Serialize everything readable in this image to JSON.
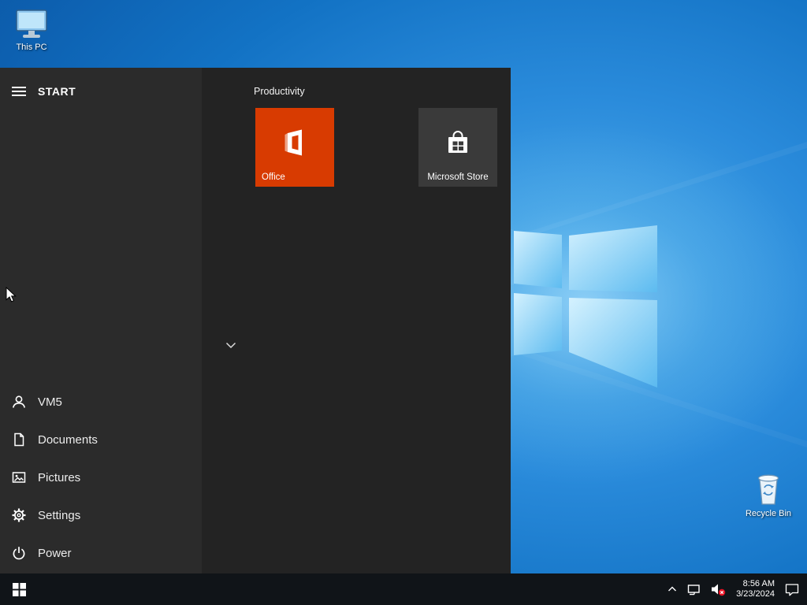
{
  "colors": {
    "taskbar_bg": "#101418",
    "start_menu_bg": "#232323",
    "start_left_bg": "#2b2b2b",
    "office_tile": "#d83b01",
    "store_tile": "#3a3a3a",
    "mute_badge_red": "#e81123",
    "wallpaper_blue": "#1272c4",
    "logo_pane_blue": "#8ed7f8"
  },
  "desktop": {
    "icons": [
      {
        "name": "this-pc",
        "label": "This PC"
      },
      {
        "name": "recycle-bin",
        "label": "Recycle Bin"
      }
    ]
  },
  "start_menu": {
    "header": "START",
    "group_title": "Productivity",
    "tiles": [
      {
        "label": "Office",
        "icon": "office-logo-icon"
      },
      {
        "label": "Microsoft Store",
        "icon": "store-bag-icon"
      }
    ],
    "nav_items": [
      {
        "label": "VM5",
        "icon": "user-icon"
      },
      {
        "label": "Documents",
        "icon": "documents-icon"
      },
      {
        "label": "Pictures",
        "icon": "pictures-icon"
      },
      {
        "label": "Settings",
        "icon": "gear-icon"
      },
      {
        "label": "Power",
        "icon": "power-icon"
      }
    ],
    "more_icon": "chevron-down-icon"
  },
  "taskbar": {
    "start_icon": "windows-logo-icon",
    "tray_icons": [
      "hidden-icons-chevron",
      "network-icon",
      "volume-muted-icon",
      "action-center-icon"
    ],
    "clock": {
      "time": "8:56 AM",
      "date": "3/23/2024"
    }
  }
}
